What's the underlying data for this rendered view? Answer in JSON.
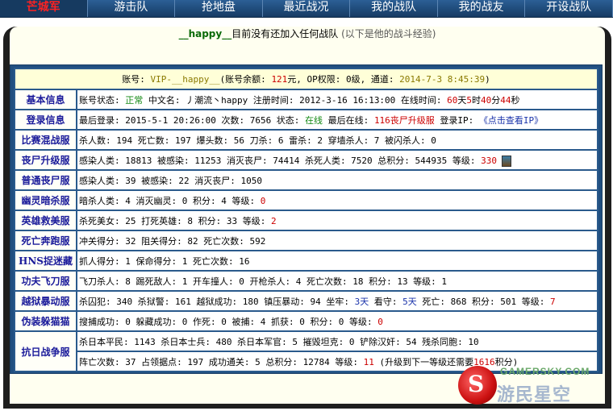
{
  "nav": {
    "items": [
      "芒城军",
      "游击队",
      "抢地盘",
      "最近战况",
      "我的战队",
      "我的战友",
      "开设战队"
    ]
  },
  "headline": {
    "nick": "__happy__",
    "text": "目前没有还加入任何战队",
    "note": "(以下是他的战斗经验)"
  },
  "account": {
    "prefix": "账号: ",
    "vip": "VIP-__happy__",
    "balance_prefix": "(账号余额: ",
    "balance": "121",
    "balance_suffix": "元, OP权限: 0级, 通道: ",
    "date": "2014-7-3 8:45:39",
    "suffix": ")"
  },
  "rows": {
    "basic": {
      "label": "基本信息",
      "a": "账号状态: ",
      "status": "正常",
      "b": " 中文名: 丿潮流丶happy 注册时间: 2012-3-16 16:13:00 在线时间: ",
      "t1": "60",
      "t2": "天",
      "t3": "5",
      "t4": "时",
      "t5": "40",
      "t6": "分",
      "t7": "44",
      "t8": "秒"
    },
    "login": {
      "label": "登录信息",
      "a": "最后登录: 2015-5-1 20:26:00 次数: 7656 状态: ",
      "online": "在线",
      "b": " 最后在线: ",
      "server": "116丧尸升级服",
      "c": " 登录IP: ",
      "ip": "《点击查看IP》"
    },
    "mix": {
      "label": "比赛混战服",
      "text": "杀人数: 194 死亡数: 197 爆头数: 56 刀杀: 6 雷杀: 2 穿墙杀人: 7 被闪杀人: 0"
    },
    "zombie": {
      "label": "丧尸升级服",
      "a": "感染人类: 18813 被感染: 11253 消灭丧尸: 74414 杀死人类: 7520 总积分: 544935 等级: ",
      "level": "330"
    },
    "normal_zombie": {
      "label": "普通丧尸服",
      "text": "感染人类: 39 被感染: 22 消灭丧尸: 1050"
    },
    "ghost": {
      "label": "幽灵暗杀服",
      "a": "暗杀人类: 4 消灭幽灵: 0 积分: 4 等级: ",
      "level": "0"
    },
    "hero": {
      "label": "英雄救美服",
      "a": "杀死美女: 25 打死英雄: 8 积分: 33 等级: ",
      "level": "2"
    },
    "death": {
      "label": "死亡奔跑服",
      "text": "冲关得分: 32 阻关得分: 82 死亡次数: 592"
    },
    "hns": {
      "label": "HNS捉迷藏",
      "text": "抓人得分: 1 保命得分: 1 死亡次数: 16"
    },
    "kungfu": {
      "label": "功夫飞刀服",
      "text": "飞刀杀人: 8 踢死敌人: 1 开车撞人: 0 开枪杀人: 4 死亡次数: 18 积分: 13 等级: 1"
    },
    "jail": {
      "label": "越狱暴动服",
      "a": "杀囚犯: 340 杀狱警: 161 越狱成功: 180 镇压暴动: 94 坐牢: ",
      "jail_days": "3天",
      "b": " 看守: ",
      "guard_days": "5天",
      "c": " 死亡: 868 积分: 501 等级: ",
      "level": "7"
    },
    "cat": {
      "label": "伪装躲猫猫",
      "text": "搜捕成功: 0 躲藏成功: 0 作死: 0 被捕: 4 抓获: 0 积分: 0 等级: ",
      "level": "0"
    },
    "war1": {
      "label": "抗日战争服",
      "text": "杀日本平民: 1143 杀日本士兵: 480 杀日本军官: 5 摧毁坦克: 0 铲除汉奸: 54 残杀同胞: 10"
    },
    "war2": {
      "a": "阵亡次数: 37 占领据点: 197 成功通关: 5 总积分: 12784 等级: ",
      "level": "11",
      "b": " (升级到下一等级还需要",
      "need": "1616",
      "c": "积分)"
    }
  },
  "watermark": {
    "top": "GAMERSKY.COM",
    "mid": "游民星空",
    "logo": "S"
  },
  "colors": {
    "nav_bg": "#1f4b7a",
    "panel_bg": "#214f80",
    "label_text": "#1a1a9a",
    "status_green": "#118811",
    "alert_red": "#cc0000"
  }
}
